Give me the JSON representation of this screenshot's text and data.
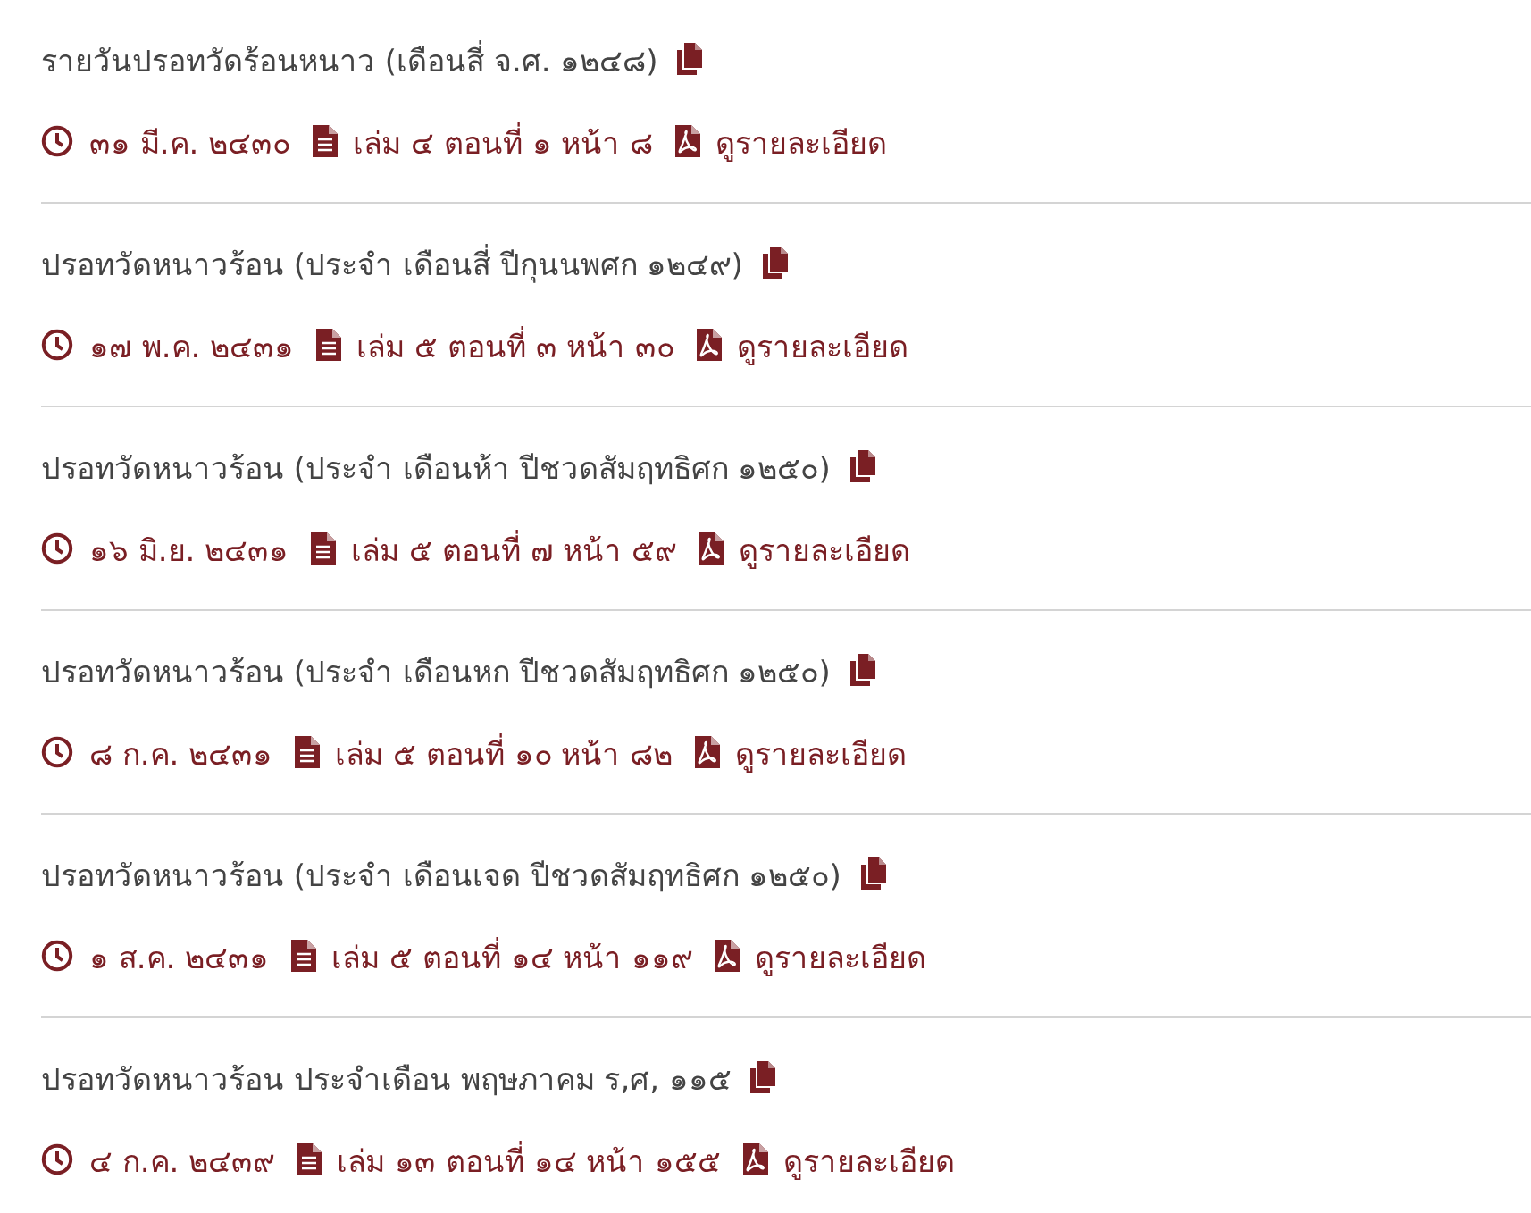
{
  "entries": [
    {
      "title": "รายวันปรอทวัดร้อนหนาว (เดือนสี่ จ.ศ. ๑๒๔๘)",
      "date": "๓๑ มี.ค. ๒๔๓๐",
      "issue": "เล่ม ๔ ตอนที่ ๑ หน้า ๘",
      "link": "ดูรายละเอียด"
    },
    {
      "title": "ปรอทวัดหนาวร้อน (ประจำ เดือนสี่ ปีกุนนพศก ๑๒๔๙)",
      "date": "๑๗ พ.ค. ๒๔๓๑",
      "issue": "เล่ม ๕ ตอนที่ ๓ หน้า ๓๐",
      "link": "ดูรายละเอียด"
    },
    {
      "title": "ปรอทวัดหนาวร้อน (ประจำ เดือนห้า ปีชวดสัมฤทธิศก ๑๒๕๐)",
      "date": "๑๖ มิ.ย. ๒๔๓๑",
      "issue": "เล่ม ๕ ตอนที่ ๗ หน้า ๕๙",
      "link": "ดูรายละเอียด"
    },
    {
      "title": "ปรอทวัดหนาวร้อน (ประจำ เดือนหก ปีชวดสัมฤทธิศก ๑๒๕๐)",
      "date": "๘ ก.ค. ๒๔๓๑",
      "issue": "เล่ม ๕ ตอนที่ ๑๐ หน้า ๘๒",
      "link": "ดูรายละเอียด"
    },
    {
      "title": "ปรอทวัดหนาวร้อน (ประจำ เดือนเจด ปีชวดสัมฤทธิศก ๑๒๕๐)",
      "date": "๑ ส.ค. ๒๔๓๑",
      "issue": "เล่ม ๕ ตอนที่ ๑๔ หน้า ๑๑๙",
      "link": "ดูรายละเอียด"
    },
    {
      "title": "ปรอทวัดหนาวร้อน ประจำเดือน พฤษภาคม ร,ศ, ๑๑๕",
      "date": "๔ ก.ค. ๒๔๓๙",
      "issue": "เล่ม ๑๓ ตอนที่ ๑๔ หน้า ๑๕๕",
      "link": "ดูรายละเอียด"
    }
  ]
}
